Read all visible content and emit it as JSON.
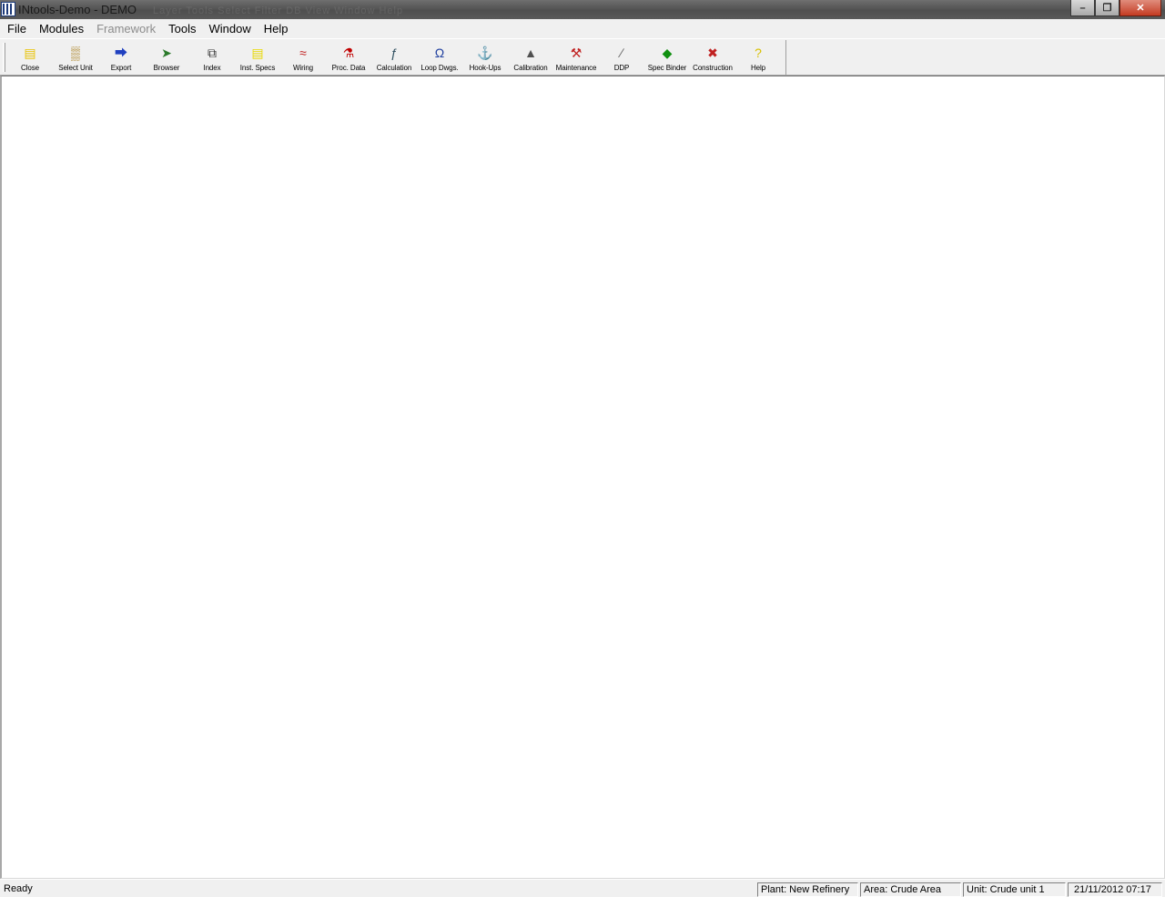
{
  "window": {
    "title": "INtools-Demo - DEMO",
    "ghost_menu": "Layer   Tools   Select   Filter   DB   View   Window   Help",
    "minimize": "–",
    "restore": "❐",
    "close": "✕"
  },
  "menu": {
    "file": "File",
    "modules": "Modules",
    "framework": "Framework",
    "tools": "Tools",
    "window": "Window",
    "help": "Help"
  },
  "toolbar": {
    "items": [
      {
        "label": "Close",
        "icon": "folder-close-icon",
        "color": "#e8c200"
      },
      {
        "label": "Select Unit",
        "icon": "factory-icon",
        "color": "#a07000"
      },
      {
        "label": "Export",
        "icon": "export-icon",
        "color": "#2040c0"
      },
      {
        "label": "Browser",
        "icon": "browser-icon",
        "color": "#2a7a2a"
      },
      {
        "label": "Index",
        "icon": "index-icon",
        "color": "#303030"
      },
      {
        "label": "Inst. Specs",
        "icon": "specs-icon",
        "color": "#e8d800"
      },
      {
        "label": "Wiring",
        "icon": "wiring-icon",
        "color": "#c02020"
      },
      {
        "label": "Proc. Data",
        "icon": "flask-icon",
        "color": "#c00000"
      },
      {
        "label": "Calculation",
        "icon": "calculation-icon",
        "color": "#305060"
      },
      {
        "label": "Loop Dwgs.",
        "icon": "loop-icon",
        "color": "#2040a0"
      },
      {
        "label": "Hook-Ups",
        "icon": "hook-icon",
        "color": "#303030"
      },
      {
        "label": "Calibration",
        "icon": "calibration-icon",
        "color": "#505050"
      },
      {
        "label": "Maintenance",
        "icon": "maintenance-icon",
        "color": "#c02020"
      },
      {
        "label": "DDP",
        "icon": "ruler-icon",
        "color": "#606060"
      },
      {
        "label": "Spec Binder",
        "icon": "binder-icon",
        "color": "#109010"
      },
      {
        "label": "Construction",
        "icon": "construction-icon",
        "color": "#c02020"
      },
      {
        "label": "Help",
        "icon": "help-icon",
        "color": "#d8c000"
      }
    ]
  },
  "status": {
    "ready": "Ready",
    "plant": "Plant: New Refinery",
    "area": "Area: Crude Area",
    "unit": "Unit: Crude unit 1",
    "datetime": "21/11/2012  07:17"
  }
}
